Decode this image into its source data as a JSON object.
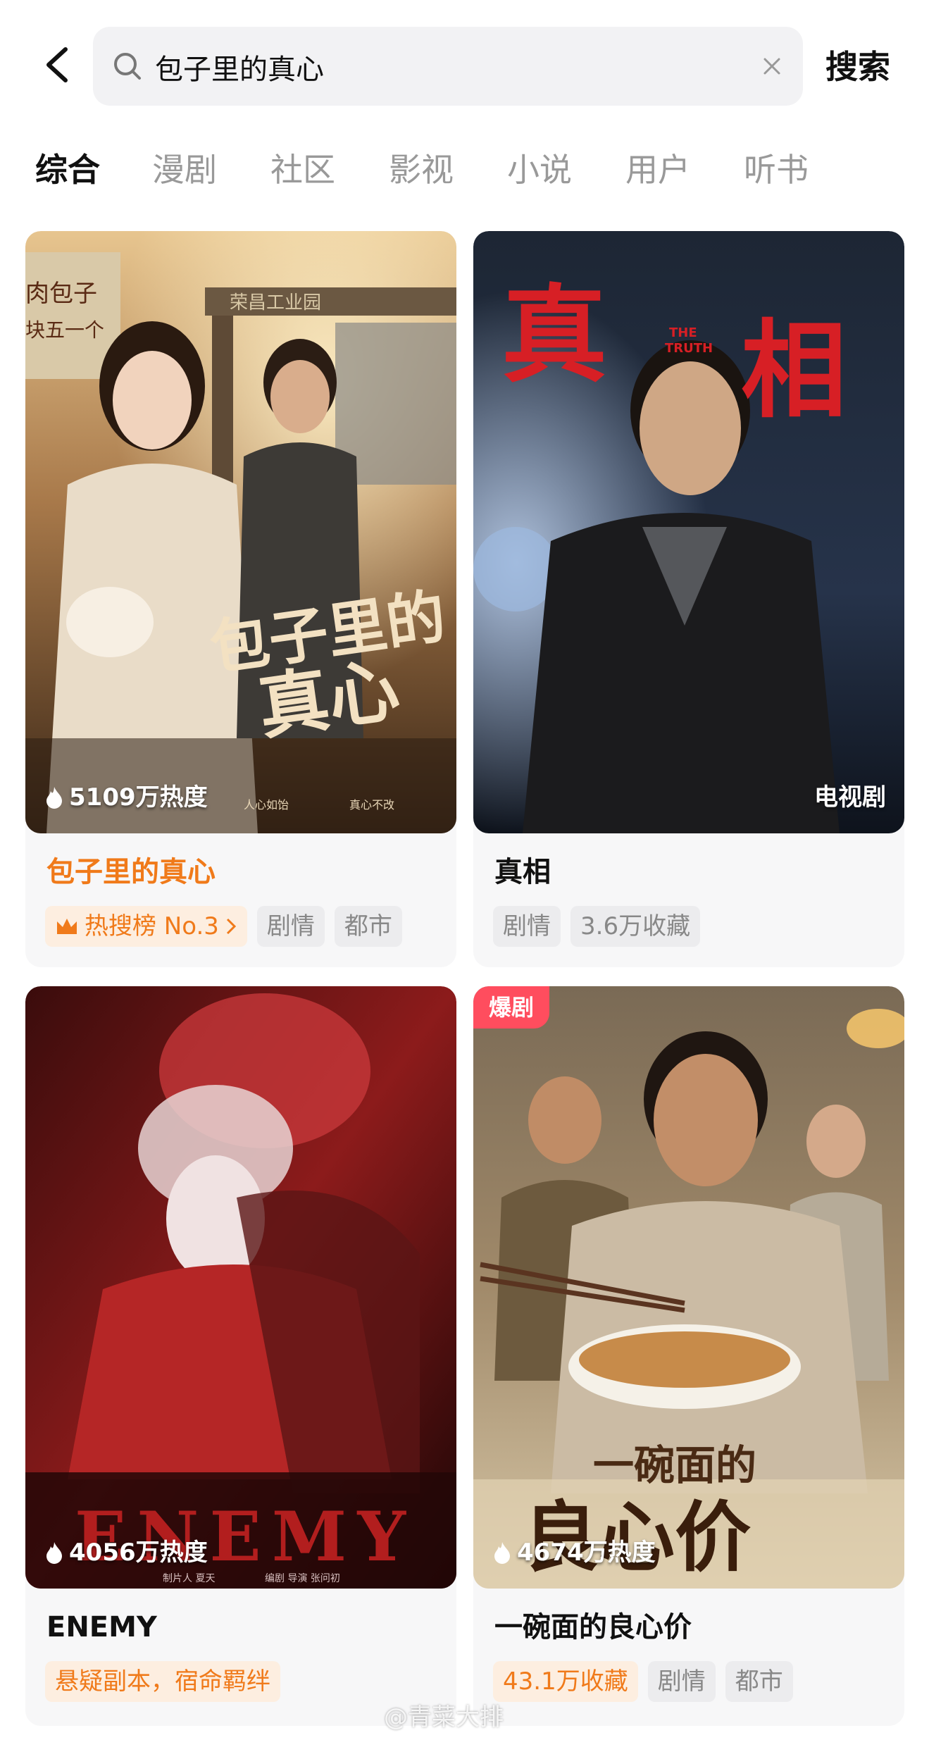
{
  "search": {
    "query": "包子里的真心",
    "button_label": "搜索"
  },
  "tabs": [
    {
      "label": "综合",
      "active": true
    },
    {
      "label": "漫剧"
    },
    {
      "label": "社区"
    },
    {
      "label": "影视"
    },
    {
      "label": "小说"
    },
    {
      "label": "用户"
    },
    {
      "label": "听书"
    }
  ],
  "cards": [
    {
      "title": "包子里的真心",
      "heat": "5109万热度",
      "poster_text": [
        "肉包子",
        "块五一个",
        "包子里的",
        "真心",
        "人心如饴",
        "真心不改",
        "荣昌工业园"
      ],
      "tags": [
        "热搜榜 No.3",
        "剧情",
        "都市"
      ],
      "title_color": "#f07a1a"
    },
    {
      "title": "真相",
      "type_label": "电视剧",
      "poster_text": [
        "真",
        "相",
        "THE",
        "TRUTH"
      ],
      "tags": [
        "剧情",
        "3.6万收藏"
      ]
    },
    {
      "title": "ENEMY",
      "heat": "4056万热度",
      "poster_text": [
        "ENEMY",
        "制片人 夏天",
        "编剧 导演 张问初"
      ],
      "tags": [
        "悬疑副本，宿命羁绊"
      ]
    },
    {
      "title": "一碗面的良心价",
      "badge": "爆剧",
      "heat": "4674万热度",
      "poster_text": [
        "一碗面的",
        "良心价"
      ],
      "tags": [
        "43.1万收藏",
        "剧情",
        "都市"
      ]
    }
  ],
  "watermark": "@青菜大排",
  "colors": {
    "accent_orange": "#f07a1a",
    "badge_red": "#ff4d5e",
    "tab_inactive": "#999999"
  },
  "icons": {
    "back": "chevron-left-icon",
    "search": "search-icon",
    "clear": "close-icon",
    "heat": "flame-icon",
    "hot_rank": "crown-icon"
  }
}
